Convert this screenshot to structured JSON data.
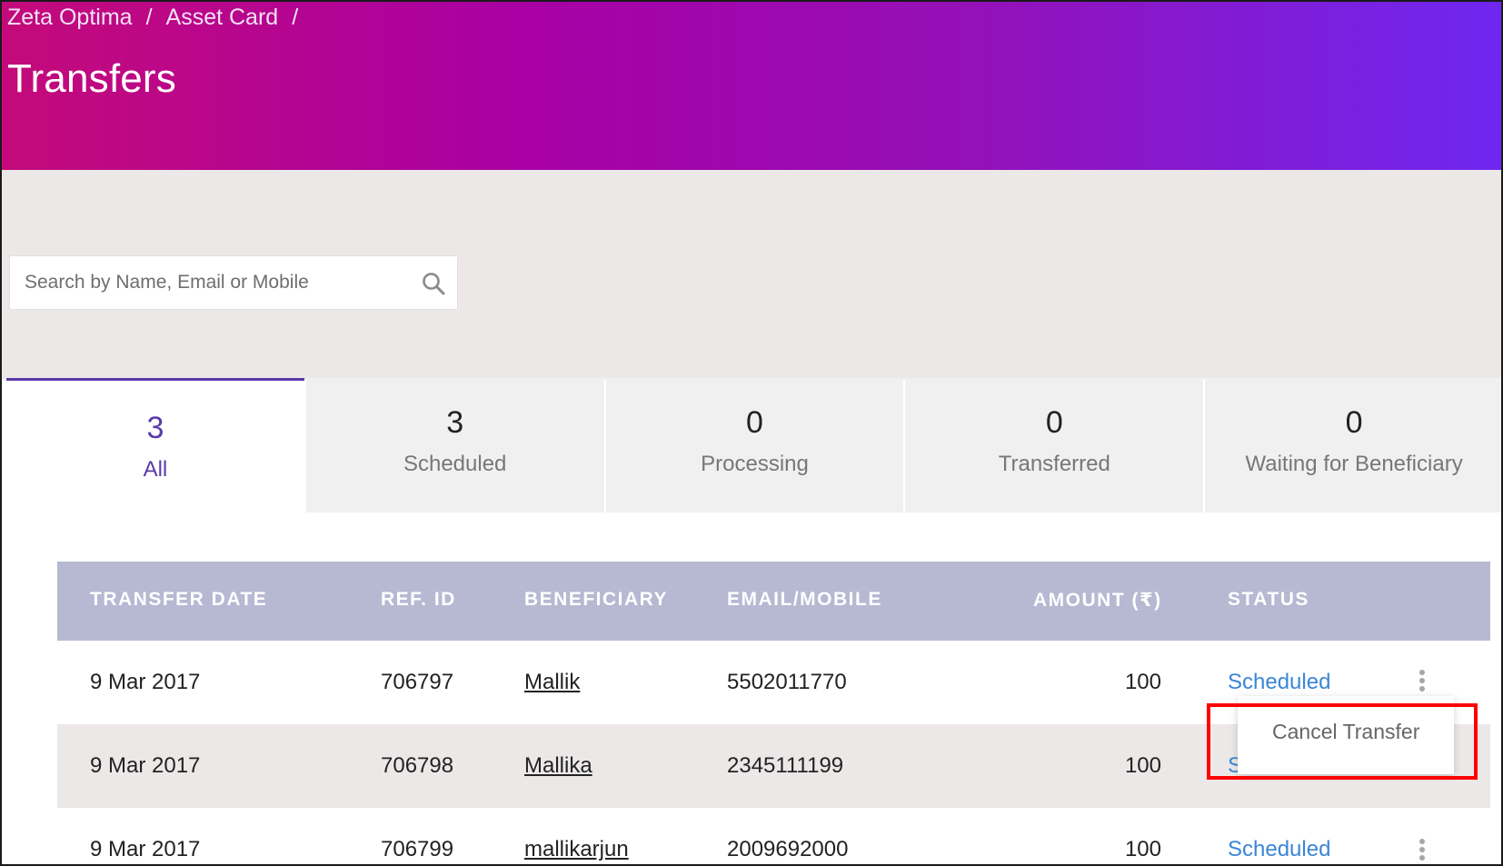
{
  "breadcrumb": {
    "items": [
      "Zeta Optima",
      "Asset Card"
    ],
    "separator": "/"
  },
  "page": {
    "title": "Transfers"
  },
  "search": {
    "placeholder": "Search by Name, Email or Mobile",
    "icon": "search-icon"
  },
  "tabs": [
    {
      "count": "3",
      "label": "All",
      "active": true
    },
    {
      "count": "3",
      "label": "Scheduled",
      "active": false
    },
    {
      "count": "0",
      "label": "Processing",
      "active": false
    },
    {
      "count": "0",
      "label": "Transferred",
      "active": false
    },
    {
      "count": "0",
      "label": "Waiting for Beneficiary",
      "active": false
    }
  ],
  "table": {
    "headers": {
      "date": "TRANSFER DATE",
      "ref": "REF. ID",
      "beneficiary": "BENEFICIARY",
      "contact": "EMAIL/MOBILE",
      "amount": "AMOUNT (₹)",
      "status": "STATUS"
    },
    "rows": [
      {
        "date": "9 Mar 2017",
        "ref": "706797",
        "beneficiary": "Mallik",
        "contact": "5502011770",
        "amount": "100",
        "status": "Scheduled"
      },
      {
        "date": "9 Mar 2017",
        "ref": "706798",
        "beneficiary": "Mallika",
        "contact": "2345111199",
        "amount": "100",
        "status": "S"
      },
      {
        "date": "9 Mar 2017",
        "ref": "706799",
        "beneficiary": "mallikarjun",
        "contact": "2009692000",
        "amount": "100",
        "status": "Scheduled"
      }
    ]
  },
  "row_menu": {
    "items": [
      "Cancel Transfer"
    ]
  },
  "colors": {
    "header_gradient_start": "#c40a7a",
    "header_gradient_end": "#6f27f0",
    "accent_purple": "#5b3aa8",
    "status_blue": "#3a86d6",
    "table_header_bg": "#b7b8d2",
    "highlight_red": "#ff0000"
  }
}
